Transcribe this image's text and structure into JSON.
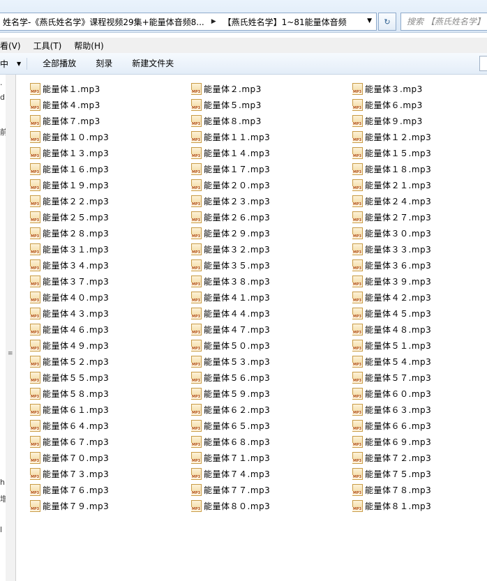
{
  "address": {
    "crumbs": [
      "姓名学-《燕氏姓名学》课程视频29集+能量体音频8...",
      "【燕氏姓名学】1~81能量体音频"
    ],
    "search_placeholder": "搜索 【燕氏姓名学】"
  },
  "menu": [
    "看(V)",
    "工具(T)",
    "帮助(H)"
  ],
  "toolbar": {
    "first": "中",
    "play_all": "全部播放",
    "burn": "刻录",
    "new_folder": "新建文件夹"
  },
  "nav_fragments": [
    "·",
    "d:",
    "前",
    "≡",
    "h",
    "增",
    "l"
  ],
  "files": [
    "能量体１.mp3",
    "能量体２.mp3",
    "能量体３.mp3",
    "能量体４.mp3",
    "能量体５.mp3",
    "能量体６.mp3",
    "能量体７.mp3",
    "能量体８.mp3",
    "能量体９.mp3",
    "能量体１０.mp3",
    "能量体１１.mp3",
    "能量体１２.mp3",
    "能量体１３.mp3",
    "能量体１４.mp3",
    "能量体１５.mp3",
    "能量体１６.mp3",
    "能量体１７.mp3",
    "能量体１８.mp3",
    "能量体１９.mp3",
    "能量体２０.mp3",
    "能量体２１.mp3",
    "能量体２２.mp3",
    "能量体２３.mp3",
    "能量体２４.mp3",
    "能量体２５.mp3",
    "能量体２６.mp3",
    "能量体２７.mp3",
    "能量体２８.mp3",
    "能量体２９.mp3",
    "能量体３０.mp3",
    "能量体３１.mp3",
    "能量体３２.mp3",
    "能量体３３.mp3",
    "能量体３４.mp3",
    "能量体３５.mp3",
    "能量体３６.mp3",
    "能量体３７.mp3",
    "能量体３８.mp3",
    "能量体３９.mp3",
    "能量体４０.mp3",
    "能量体４１.mp3",
    "能量体４２.mp3",
    "能量体４３.mp3",
    "能量体４４.mp3",
    "能量体４５.mp3",
    "能量体４６.mp3",
    "能量体４７.mp3",
    "能量体４８.mp3",
    "能量体４９.mp3",
    "能量体５０.mp3",
    "能量体５１.mp3",
    "能量体５２.mp3",
    "能量体５３.mp3",
    "能量体５４.mp3",
    "能量体５５.mp3",
    "能量体５６.mp3",
    "能量体５７.mp3",
    "能量体５８.mp3",
    "能量体５９.mp3",
    "能量体６０.mp3",
    "能量体６１.mp3",
    "能量体６２.mp3",
    "能量体６３.mp3",
    "能量体６４.mp3",
    "能量体６５.mp3",
    "能量体６６.mp3",
    "能量体６７.mp3",
    "能量体６８.mp3",
    "能量体６９.mp3",
    "能量体７０.mp3",
    "能量体７１.mp3",
    "能量体７２.mp3",
    "能量体７３.mp3",
    "能量体７４.mp3",
    "能量体７５.mp3",
    "能量体７６.mp3",
    "能量体７７.mp3",
    "能量体７８.mp3",
    "能量体７９.mp3",
    "能量体８０.mp3",
    "能量体８１.mp3"
  ]
}
